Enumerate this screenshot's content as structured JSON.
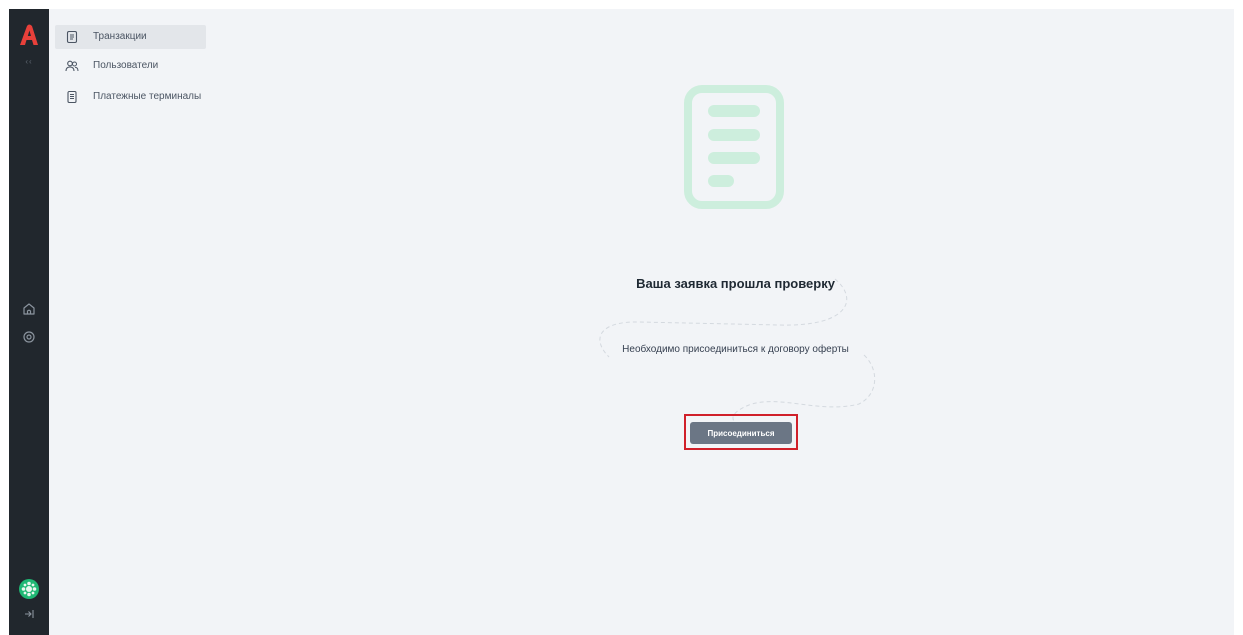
{
  "rail": {
    "logo_icon": "app-logo-a",
    "collapse_label": "‹‹",
    "icons": [
      "home-icon",
      "settings-icon"
    ],
    "avatar_icon": "avatar-icon",
    "logout_icon": "logout-icon"
  },
  "nav": {
    "items": [
      {
        "label": "Транзакции",
        "icon": "document-icon",
        "active": true
      },
      {
        "label": "Пользователи",
        "icon": "users-icon",
        "active": false
      },
      {
        "label": "Платежные терминалы",
        "icon": "terminal-icon",
        "active": false
      }
    ]
  },
  "main": {
    "title": "Ваша заявка прошла проверку",
    "subtitle": "Необходимо присоединиться к договору оферты",
    "join_button": "Присоединиться"
  },
  "colors": {
    "rail_bg": "#21272d",
    "logo": "#e8403a",
    "page_bg": "#f2f4f7",
    "illustration": "#cdeedd",
    "button_bg": "#6b7685",
    "highlight": "#d0202a",
    "avatar": "#1fb874"
  }
}
